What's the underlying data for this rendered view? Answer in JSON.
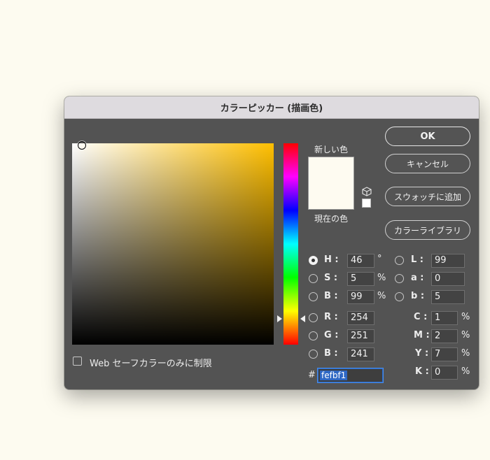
{
  "dialog": {
    "title": "カラーピッカー (描画色)",
    "new_label": "新しい色",
    "current_label": "現在の色",
    "websafe_label": "Web セーフカラーのみに制限",
    "hex_prefix": "#"
  },
  "buttons": {
    "ok": "OK",
    "cancel": "キャンセル",
    "add_swatch": "スウォッチに追加",
    "libraries": "カラーライブラリ"
  },
  "hsb": {
    "h": {
      "label": "H :",
      "value": "46",
      "unit": "°"
    },
    "s": {
      "label": "S :",
      "value": "5",
      "unit": "%"
    },
    "b": {
      "label": "B :",
      "value": "99",
      "unit": "%"
    }
  },
  "lab": {
    "l": {
      "label": "L :",
      "value": "99"
    },
    "a": {
      "label": "a :",
      "value": "0"
    },
    "b": {
      "label": "b :",
      "value": "5"
    }
  },
  "rgb": {
    "r": {
      "label": "R :",
      "value": "254"
    },
    "g": {
      "label": "G :",
      "value": "251"
    },
    "b": {
      "label": "B :",
      "value": "241"
    }
  },
  "cmyk": {
    "c": {
      "label": "C :",
      "value": "1",
      "unit": "%"
    },
    "m": {
      "label": "M :",
      "value": "2",
      "unit": "%"
    },
    "y": {
      "label": "Y :",
      "value": "7",
      "unit": "%"
    },
    "k": {
      "label": "K :",
      "value": "0",
      "unit": "%"
    }
  },
  "hex": {
    "value": "fefbf1"
  },
  "colors": {
    "new": "#fefbf1",
    "current": "#fefbf1",
    "hue_base": "#ffbf00",
    "selection": "#2f68c4"
  },
  "icons": {
    "gamut_cube": "cube-icon",
    "websafe_checkbox": "checkbox"
  }
}
